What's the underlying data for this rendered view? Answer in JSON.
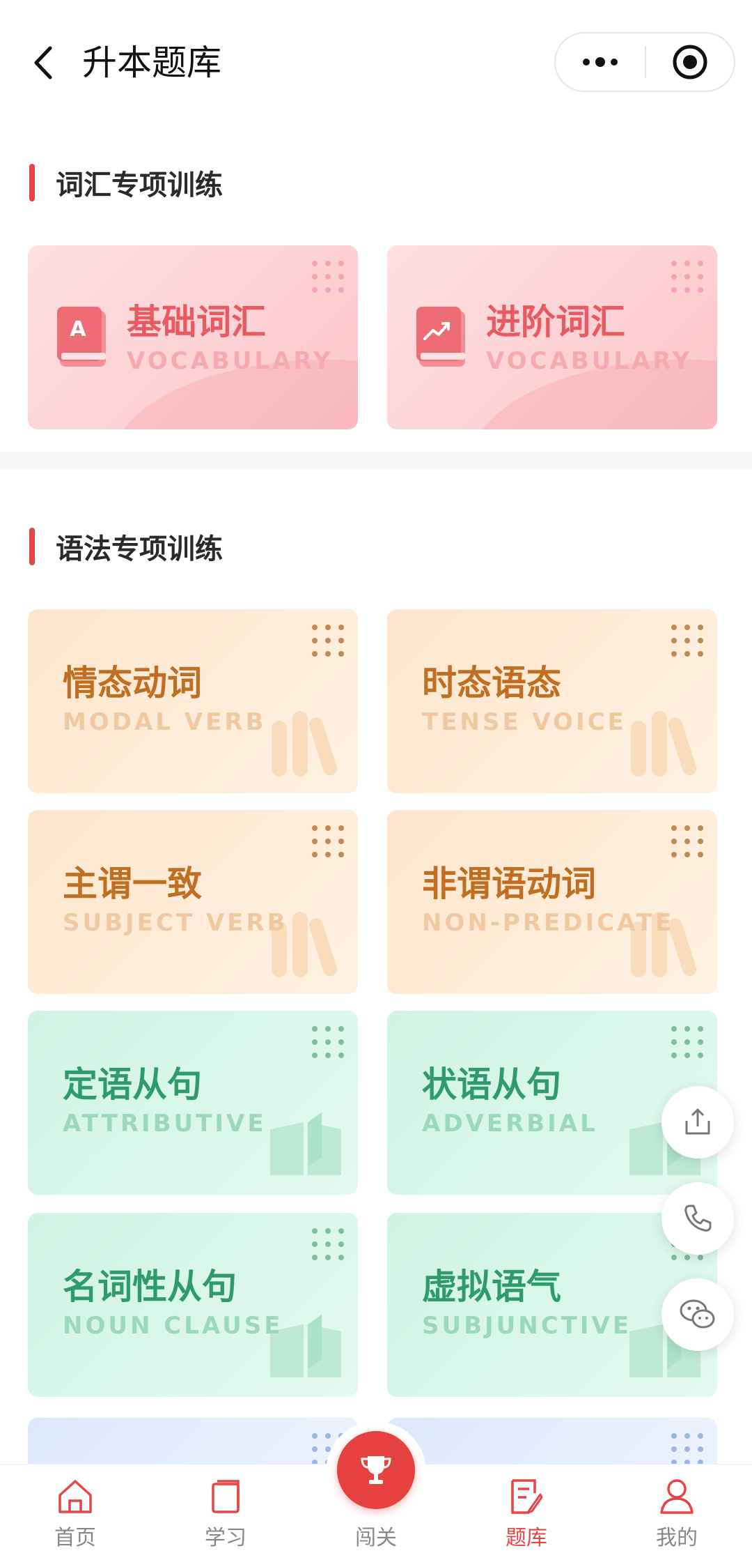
{
  "header": {
    "title": "升本题库"
  },
  "sections": [
    {
      "title": "词汇专项训练"
    },
    {
      "title": "语法专项训练"
    }
  ],
  "vocab_cards": [
    {
      "title": "基础词汇",
      "sub": "VOCABULARY",
      "icon": "letter-a-book-icon"
    },
    {
      "title": "进阶词汇",
      "sub": "VOCABULARY",
      "icon": "trend-book-icon"
    }
  ],
  "grammar_cards": [
    {
      "title": "情态动词",
      "sub": "MODAL VERB"
    },
    {
      "title": "时态语态",
      "sub": "TENSE VOICE"
    },
    {
      "title": "主谓一致",
      "sub": "SUBJECT VERB"
    },
    {
      "title": "非谓语动词",
      "sub": "NON-PREDICATE"
    },
    {
      "title": "定语从句",
      "sub": "ATTRIBUTIVE"
    },
    {
      "title": "状语从句",
      "sub": "ADVERBIAL"
    },
    {
      "title": "名词性从句",
      "sub": "NOUN CLAUSE"
    },
    {
      "title": "虚拟语气",
      "sub": "SUBJUNCTIVE"
    }
  ],
  "tabs": [
    {
      "label": "首页",
      "icon": "home-icon",
      "active": false
    },
    {
      "label": "学习",
      "icon": "book-icon",
      "active": false
    },
    {
      "label": "闯关",
      "icon": "trophy-icon",
      "active": false
    },
    {
      "label": "题库",
      "icon": "question-bank-icon",
      "active": true
    },
    {
      "label": "我的",
      "icon": "user-icon",
      "active": false
    }
  ],
  "colors": {
    "accent": "#e54545",
    "pink_title": "#e85a60",
    "peach_title": "#c06f22",
    "mint_title": "#2f9b6d"
  }
}
